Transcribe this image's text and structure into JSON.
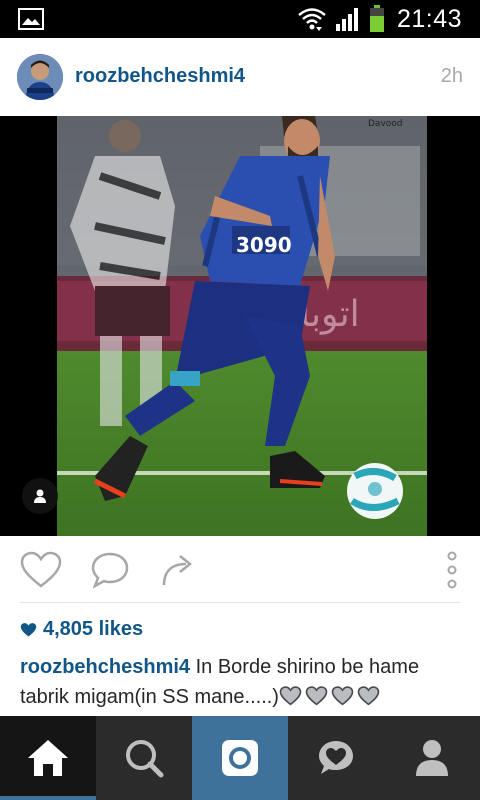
{
  "status_bar": {
    "time": "21:43",
    "icons": [
      "image-notification-icon",
      "wifi-icon",
      "signal-icon",
      "battery-icon"
    ]
  },
  "post": {
    "username": "roozbehcheshmi4",
    "time_ago": "2h",
    "photo_watermark": "Davood",
    "photo_description": "Football player in blue kit dribbling a ball on the pitch",
    "likes_count": "4,805 likes",
    "caption_user": "roozbehcheshmi4",
    "caption_text": "In Borde shirino be hame tabrik migam(in SS mane.....)",
    "caption_hearts": [
      "🩶",
      "🩶",
      "🩶",
      "🩶"
    ]
  },
  "actions": [
    "like-icon",
    "comment-icon",
    "share-icon",
    "more-options-icon"
  ],
  "tabs": [
    {
      "name": "home",
      "icon": "home-icon"
    },
    {
      "name": "explore",
      "icon": "search-icon"
    },
    {
      "name": "camera",
      "icon": "camera-icon"
    },
    {
      "name": "activity",
      "icon": "activity-heart-icon"
    },
    {
      "name": "profile",
      "icon": "profile-icon"
    }
  ],
  "colors": {
    "accent": "#3f729b",
    "username": "#125688",
    "tabbar": "#2b2b2b"
  }
}
